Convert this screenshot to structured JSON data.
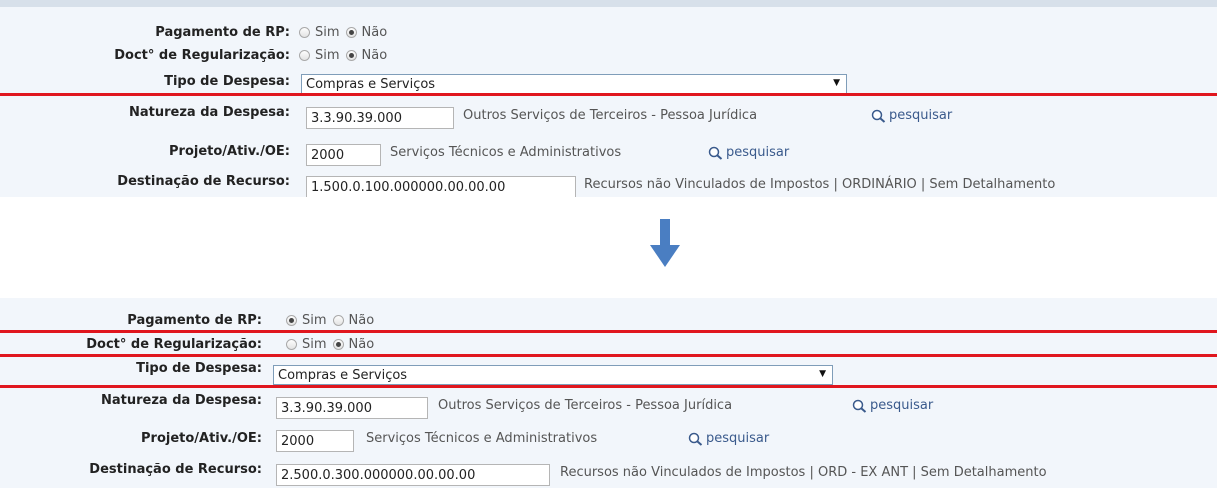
{
  "labels": {
    "pagamento_rp": "Pagamento de RP:",
    "doct_regularizacao": "Doct° de Regularização:",
    "tipo_despesa": "Tipo de Despesa:",
    "natureza_despesa": "Natureza da Despesa:",
    "projeto": "Projeto/Ativ./OE:",
    "destinacao": "Destinação de Recurso:"
  },
  "options": {
    "sim": "Sim",
    "nao": "Não"
  },
  "search_label": "pesquisar",
  "before": {
    "pagamento_rp_selected": "Não",
    "doct_regularizacao_selected": "Não",
    "tipo_despesa_value": "Compras e Serviços",
    "natureza_code": "3.3.90.39.000",
    "natureza_desc": "Outros Serviços de Terceiros - Pessoa Jurídica",
    "projeto_code": "2000",
    "projeto_desc": "Serviços Técnicos e Administrativos",
    "destinacao_code": "1.500.0.100.000000.00.00.00",
    "destinacao_desc": "Recursos não Vinculados de Impostos | ORDINÁRIO | Sem Detalhamento"
  },
  "after": {
    "pagamento_rp_selected": "Sim",
    "doct_regularizacao_selected": "Não",
    "tipo_despesa_value": "Compras e Serviços",
    "natureza_code": "3.3.90.39.000",
    "natureza_desc": "Outros Serviços de Terceiros - Pessoa Jurídica",
    "projeto_code": "2000",
    "projeto_desc": "Serviços Técnicos e Administrativos",
    "destinacao_code": "2.500.0.300.000000.00.00.00",
    "destinacao_desc": "Recursos não Vinculados de Impostos | ORD - EX ANT | Sem Detalhamento"
  },
  "colors": {
    "highlight": "#e0161e",
    "arrow": "#4a7ec2",
    "link": "#3a5a8c"
  },
  "icons": {
    "transition": "arrow-down-icon",
    "search": "magnifier-icon"
  }
}
